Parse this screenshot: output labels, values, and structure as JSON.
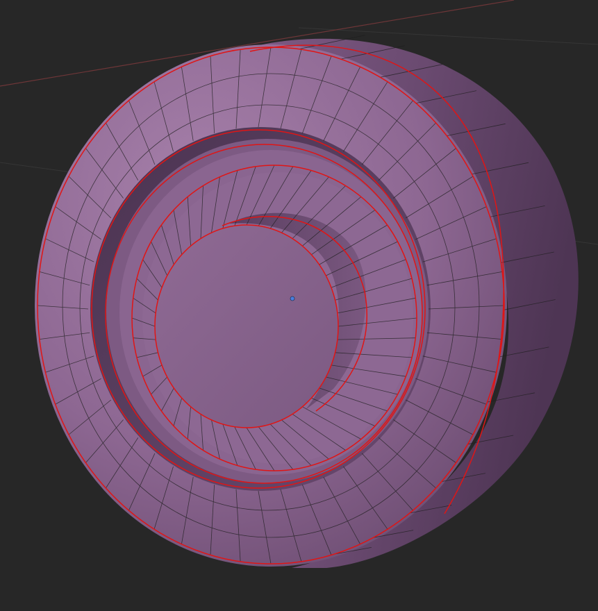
{
  "viewport": {
    "kind": "3d-viewport",
    "mode": "edit-mode",
    "object": "wheel-mesh"
  },
  "colors": {
    "background": "#272727",
    "grid_line": "#3a3a3a",
    "x_axis": "#7a3a3c",
    "mesh_face": "#8c6690",
    "mesh_face_light": "#a07ba4",
    "mesh_face_dark": "#5e4162",
    "mesh_face_shadow": "#4a3350",
    "wire_edge": "#1a1a1a",
    "seam_edge": "#e01010",
    "origin_point": "#4a7fe0"
  },
  "icons": {
    "origin": "origin-point-icon"
  }
}
